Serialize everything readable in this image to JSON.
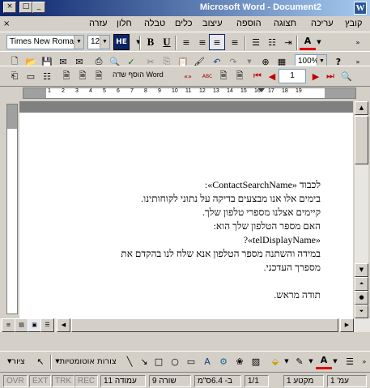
{
  "window": {
    "title": "Microsoft Word - Document2",
    "icon_letter": "W"
  },
  "caption_buttons": {
    "minimize": "_",
    "maximize": "□",
    "close": "×"
  },
  "menubar": {
    "close_glyph": "×",
    "items": [
      "קובץ",
      "עריכה",
      "תצוגה",
      "הוספה",
      "עיצוב",
      "כלים",
      "טבלה",
      "חלון",
      "עזרה"
    ]
  },
  "formatting": {
    "font_name": "Times New Roman",
    "font_size": "12",
    "lang_badge": "HE",
    "bold": "B",
    "underline": "U",
    "font_color_label": "A"
  },
  "standard": {
    "zoom": "100%",
    "help": "?"
  },
  "mailmerge": {
    "insert_field_label": "הוסף שדה Word",
    "record_number": "1",
    "merge_fields_label": "«»",
    "abc_label": "ABC"
  },
  "ruler_numbers": [
    "1",
    "2",
    "3",
    "4",
    "5",
    "6",
    "7",
    "8",
    "9",
    "10",
    "11",
    "12",
    "13",
    "14",
    "15",
    "16",
    "17",
    "18",
    "19"
  ],
  "document": {
    "lines": [
      "לכבוד «ContactSearchName»:",
      "בימים אלו אנו מבצעים בדיקה על נתוני לקוחותינו.",
      "קיימים אצלנו מספרי טלפון שלך.",
      "האם מספר הטלפון שלך הוא:",
      "«telDisplayName»?",
      "במידה והשתנה מספר הטלפון אנא שלח לנו בהקדם את",
      "מספרך העדכני.",
      "",
      "תודה מראש."
    ]
  },
  "drawing": {
    "draw_label": "ציור",
    "autoshapes_label": "צורות אוטומטיות"
  },
  "status": {
    "page": "עמ' 1",
    "section": "מקטע 1",
    "pages": "1/1",
    "at": "ב- 6.4ס\"מ",
    "line": "שורה 9",
    "col": "עמודה 11",
    "rec": "REC",
    "trk": "TRK",
    "ext": "EXT",
    "ovr": "OVR"
  }
}
